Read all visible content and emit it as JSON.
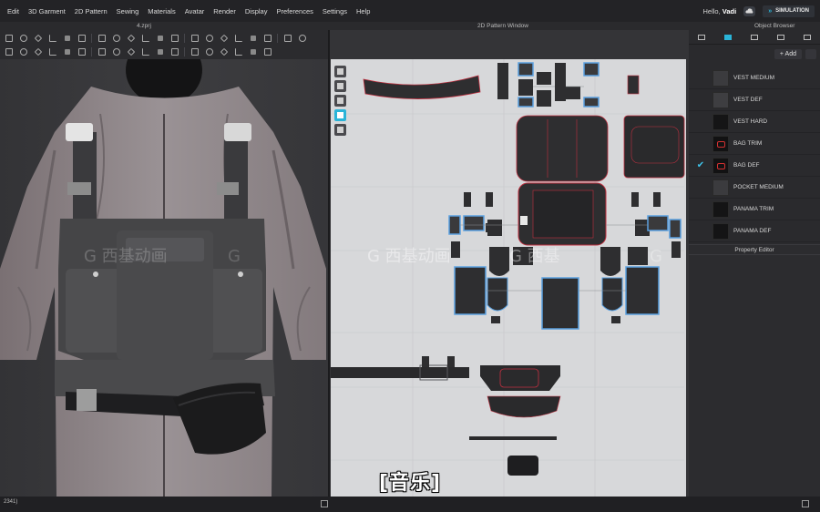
{
  "menu": {
    "items": [
      "Edit",
      "3D Garment",
      "2D Pattern",
      "Sewing",
      "Materials",
      "Avatar",
      "Render",
      "Display",
      "Preferences",
      "Settings",
      "Help"
    ],
    "greeting_prefix": "Hello,",
    "user": "Vadi",
    "simulation_label": "SIMULATION"
  },
  "windows": {
    "file_name": "4.zprj",
    "pattern_window_title": "2D Pattern Window",
    "object_browser_title": "Object Browser",
    "property_editor_title": "Property Editor"
  },
  "object_browser": {
    "add_label": "+ Add",
    "materials": [
      {
        "name": "VEST MEDIUM",
        "swatch": "#3b3b3e",
        "checked": false,
        "logo": false
      },
      {
        "name": "VEST DEF",
        "swatch": "#3e3e41",
        "checked": false,
        "logo": false
      },
      {
        "name": "VEST HARD",
        "swatch": "#151516",
        "checked": false,
        "logo": false
      },
      {
        "name": "BAG TRIM",
        "swatch": "#121213",
        "checked": false,
        "logo": true
      },
      {
        "name": "BAG DEF",
        "swatch": "#121213",
        "checked": true,
        "logo": true
      },
      {
        "name": "POCKET MEDIUM",
        "swatch": "#3b3b3e",
        "checked": false,
        "logo": false
      },
      {
        "name": "PANAMA TRIM",
        "swatch": "#141415",
        "checked": false,
        "logo": false
      },
      {
        "name": "PANAMA DEF",
        "swatch": "#141415",
        "checked": false,
        "logo": false
      }
    ]
  },
  "status": {
    "coords": "2341)"
  },
  "subtitle": "[音乐]",
  "colors": {
    "accent": "#2ab4d8",
    "check": "#3fc3ea",
    "pattern_outline": "#c03040",
    "selection_blue": "#5aa0e0"
  }
}
